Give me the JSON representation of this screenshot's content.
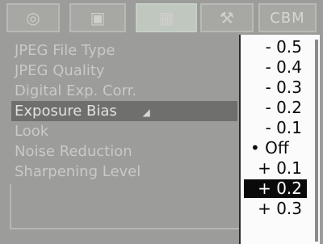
{
  "tabs": [
    {
      "label": "",
      "icon": "camera-icon"
    },
    {
      "label": "",
      "icon": "gear-icon"
    },
    {
      "label": "",
      "icon": "image-settings-icon",
      "active": true
    },
    {
      "label": "",
      "icon": "tools-icon"
    },
    {
      "label": "CBM",
      "icon": ""
    }
  ],
  "menu": {
    "items": [
      {
        "label": "JPEG File Type"
      },
      {
        "label": "JPEG Quality"
      },
      {
        "label": "Digital Exp. Corr."
      },
      {
        "label": "Exposure Bias",
        "selected": true
      },
      {
        "label": "Look"
      },
      {
        "label": "Noise Reduction"
      },
      {
        "label": "Sharpening Level"
      }
    ]
  },
  "dropdown": {
    "options": [
      "- 0.5",
      "- 0.4",
      "- 0.3",
      "- 0.2",
      "- 0.1",
      "• Off",
      "+ 0.1",
      "+ 0.2",
      "+ 0.3"
    ],
    "highlighted_index": 7
  }
}
